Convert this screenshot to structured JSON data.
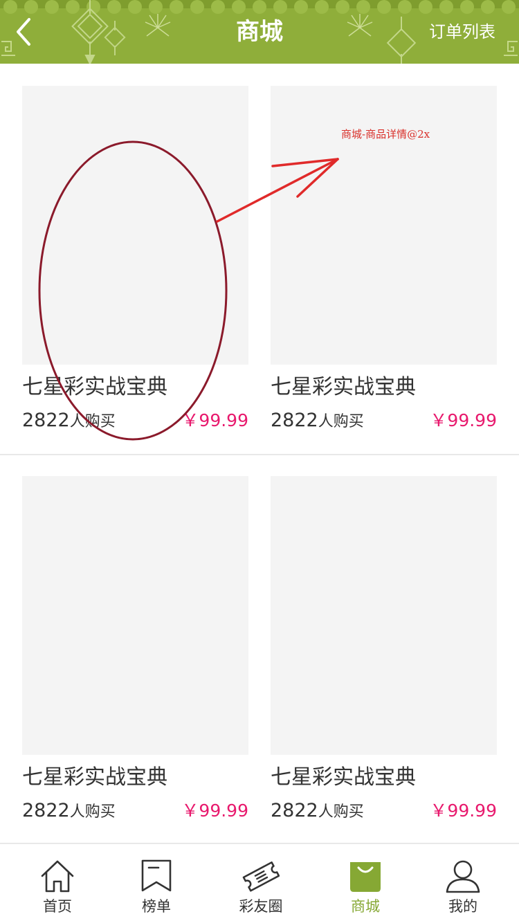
{
  "header": {
    "title": "商城",
    "order_list_label": "订单列表",
    "background_color": "#8fae3a"
  },
  "products": [
    {
      "name": "七星彩实战宝典",
      "sales_count": "2822",
      "sales_unit": "人购买",
      "price": "￥99.99"
    },
    {
      "name": "七星彩实战宝典",
      "sales_count": "2822",
      "sales_unit": "人购买",
      "price": "￥99.99"
    },
    {
      "name": "七星彩实战宝典",
      "sales_count": "2822",
      "sales_unit": "人购买",
      "price": "￥99.99"
    },
    {
      "name": "七星彩实战宝典",
      "sales_count": "2822",
      "sales_unit": "人购买",
      "price": "￥99.99"
    }
  ],
  "annotation": {
    "note": "商城-商品详情@2x",
    "color": "#d9302a",
    "ellipse_color": "#8b1a2b"
  },
  "tabbar": {
    "items": [
      {
        "label": "首页",
        "icon": "home-icon"
      },
      {
        "label": "榜单",
        "icon": "ranking-icon"
      },
      {
        "label": "彩友圈",
        "icon": "ticket-icon"
      },
      {
        "label": "商城",
        "icon": "shopping-bag-icon",
        "active": true
      },
      {
        "label": "我的",
        "icon": "user-icon"
      }
    ],
    "active_color": "#86a834"
  },
  "colors": {
    "price": "#e8196d",
    "thumbnail_placeholder": "#f4f4f4"
  }
}
